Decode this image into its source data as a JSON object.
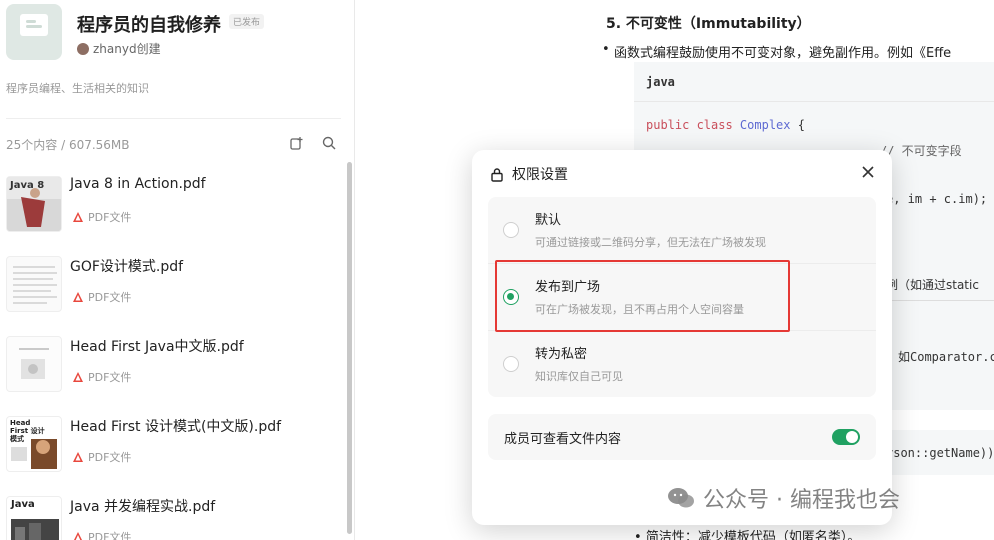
{
  "knowledge_base": {
    "title": "程序员的自我修养",
    "status": "已发布",
    "author": "zhanyd创建",
    "description": "程序员编程、生活相关的知识",
    "stats": "25个内容 / 607.56MB"
  },
  "files": [
    {
      "name": "Java 8 in Action.pdf",
      "type": "PDF文件",
      "thumb_text": "Java 8"
    },
    {
      "name": "GOF设计模式.pdf",
      "type": "PDF文件",
      "thumb_text": ""
    },
    {
      "name": "Head First Java中文版.pdf",
      "type": "PDF文件",
      "thumb_text": ""
    },
    {
      "name": "Head First 设计模式(中文版).pdf",
      "type": "PDF文件",
      "thumb_text": "Head First 设计模式"
    },
    {
      "name": "Java 并发编程实战.pdf",
      "type": "PDF文件",
      "thumb_text": "Java"
    }
  ],
  "document": {
    "heading": "5. 不可变性（Immutability）",
    "bullet1": "函数式编程鼓励使用不可变对象，避免副作用。例如《Effe",
    "code_lang": "java",
    "code_line1_kw": "public class ",
    "code_line1_name": "Complex",
    "code_line1_rest": " {",
    "code_comment": "// 不可变字段",
    "frag1": "e, im + c.im);",
    "frag2": "例（如通过static",
    "frag3": "如Comparator.c",
    "frag4": "rson::getName))",
    "bottom_bullet": "简洁性：减少模板代码（如匿名类）。"
  },
  "dialog": {
    "title": "权限设置",
    "options": [
      {
        "label": "默认",
        "desc": "可通过链接或二维码分享，但无法在广场被发现",
        "selected": false
      },
      {
        "label": "发布到广场",
        "desc": "可在广场被发现，且不再占用个人空间容量",
        "selected": true
      },
      {
        "label": "转为私密",
        "desc": "知识库仅自己可见",
        "selected": false
      }
    ],
    "member_label": "成员可查看文件内容",
    "member_toggle_on": true
  },
  "watermark": "公众号 · 编程我也会",
  "colors": {
    "accent": "#20a162",
    "highlight": "#e53935",
    "pdf": "#e8473d"
  }
}
